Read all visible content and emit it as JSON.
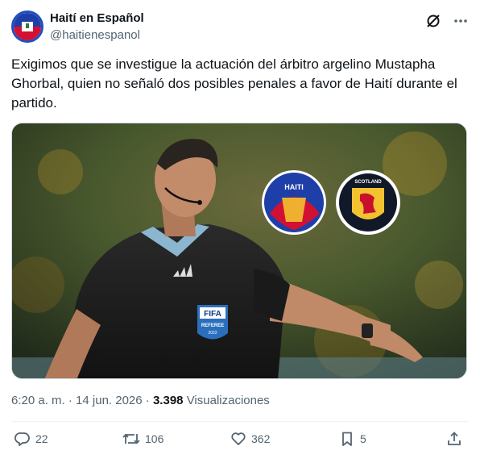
{
  "author": {
    "display_name": "Haití en Español",
    "handle": "@haitienespanol",
    "avatar_icon": "haiti-flag-icon"
  },
  "header_icons": [
    "grok-icon",
    "more-icon"
  ],
  "tweet": {
    "text": "Exigimos que se investigue la actuación del árbitro argelino Mustapha Ghorbal, quien no señaló dos posibles penales a favor de Haití durante el partido."
  },
  "media": {
    "badge_fifa": "FIFA",
    "badge_referee": "REFEREE",
    "badge_year": "2022",
    "crest_left_text": "HAITI",
    "crest_right_text": "SCOTLAND"
  },
  "meta": {
    "time": "6:20 a. m.",
    "separator": "·",
    "date": "14 jun. 2026",
    "views_count": "3.398",
    "views_label": "Visualizaciones"
  },
  "actions": {
    "replies": "22",
    "reposts": "106",
    "likes": "362",
    "bookmarks": "5"
  },
  "colors": {
    "text": "#0f1419",
    "secondary": "#536471",
    "divider": "#eff3f4"
  }
}
